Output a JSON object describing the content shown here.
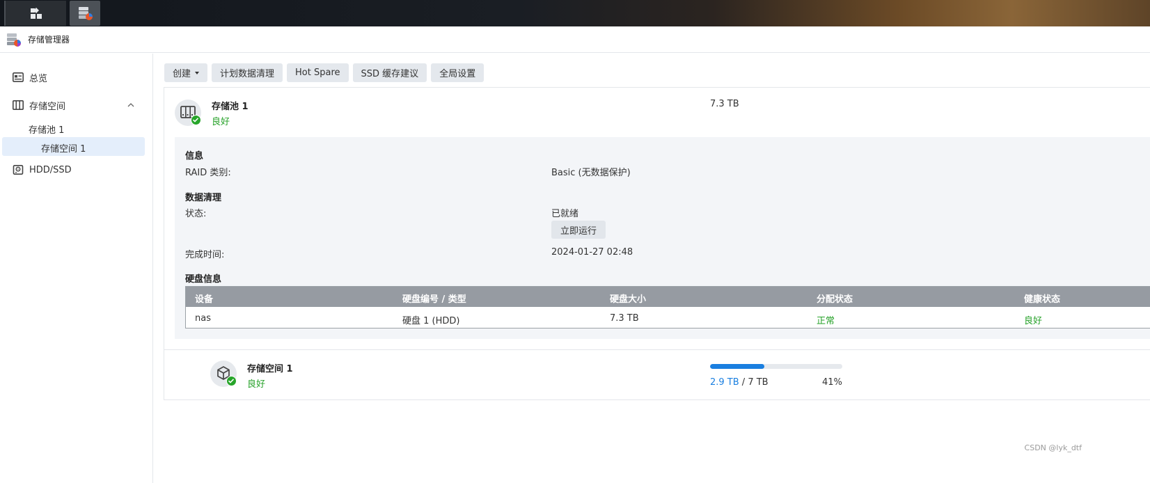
{
  "app": {
    "title": "存储管理器"
  },
  "taskbar": {
    "buttons": [
      "apps-grid-icon",
      "storage-manager-icon"
    ]
  },
  "sidebar": {
    "items": [
      {
        "label": "总览",
        "icon": "overview-icon"
      },
      {
        "label": "存储空间",
        "icon": "storage-icon",
        "expanded": true
      },
      {
        "label": "HDD/SSD",
        "icon": "disk-icon"
      }
    ],
    "pool": "存储池 1",
    "volume": "存储空间 1"
  },
  "toolbar": {
    "create": "创建",
    "schedule_scrub": "计划数据清理",
    "hot_spare": "Hot Spare",
    "ssd_cache": "SSD 缓存建议",
    "global_settings": "全局设置"
  },
  "pool": {
    "name": "存储池 1",
    "status": "良好",
    "size": "7.3 TB",
    "info": {
      "title": "信息",
      "raid_label": "RAID 类别:",
      "raid_value": "Basic (无数据保护)"
    },
    "scrub": {
      "title": "数据清理",
      "status_label": "状态:",
      "status_value": "已就绪",
      "run_button": "立即运行",
      "finish_label": "完成时间:",
      "finish_value": "2024-01-27 02:48"
    },
    "disks": {
      "title": "硬盘信息",
      "headers": [
        "设备",
        "硬盘编号 / 类型",
        "硬盘大小",
        "分配状态",
        "健康状态"
      ],
      "rows": [
        {
          "device": "nas",
          "disk": "硬盘 1 (HDD)",
          "size": "7.3 TB",
          "allocation": "正常",
          "health": "良好"
        }
      ]
    }
  },
  "volume": {
    "name": "存储空间 1",
    "status": "良好",
    "used": "2.9 TB",
    "separator": " / ",
    "total": "7 TB",
    "percent": "41%",
    "fill_fraction": 0.41
  },
  "colors": {
    "accent": "#1a7fe0",
    "ok": "#27a22a",
    "selected": "#e4eefb"
  },
  "watermark": "CSDN @lyk_dtf"
}
